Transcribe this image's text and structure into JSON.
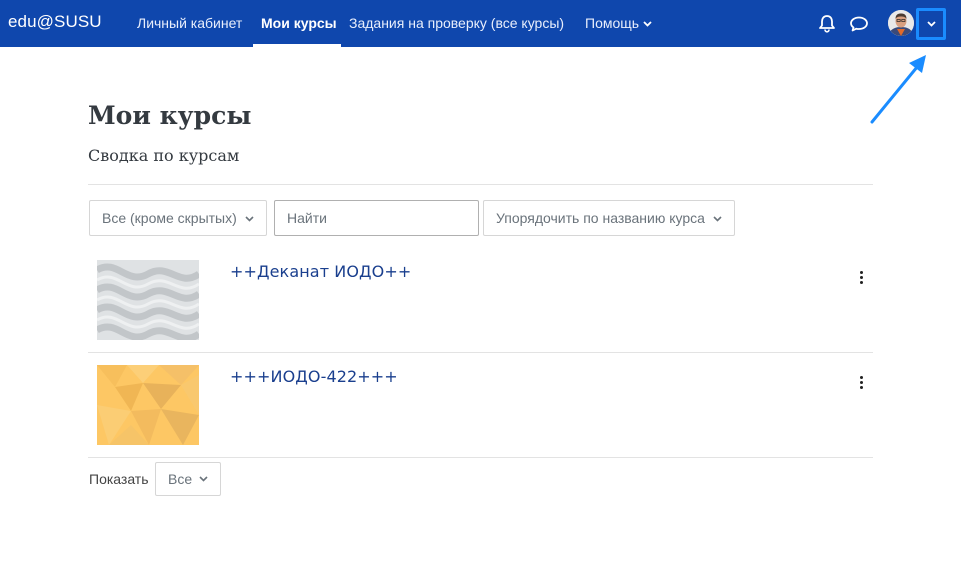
{
  "navbar": {
    "brand": "edu@SUSU",
    "items": [
      {
        "label": "Личный кабинет"
      },
      {
        "label": "Мои курсы",
        "active": true
      },
      {
        "label": "Задания на проверку (все курсы)"
      },
      {
        "label": "Помощь",
        "has_dropdown": true
      }
    ],
    "icons": [
      "bell-icon",
      "chat-bubble-icon",
      "avatar",
      "chevron-down-icon"
    ],
    "colors": {
      "background": "#0f47ad",
      "highlight": "#1a8cff"
    }
  },
  "page": {
    "title": "Мои курсы",
    "subtitle": "Сводка по курсам"
  },
  "filters": {
    "grouping": "Все (кроме скрытых)",
    "search_placeholder": "Найти",
    "sort": "Упорядочить по названию курса"
  },
  "courses": [
    {
      "name": "++Деканат ИОДО++",
      "image": "grey-waves-pattern"
    },
    {
      "name": "+++ИОДО-422+++",
      "image": "yellow-geometric-pattern"
    }
  ],
  "paging": {
    "show_label": "Показать",
    "show_value": "Все"
  }
}
